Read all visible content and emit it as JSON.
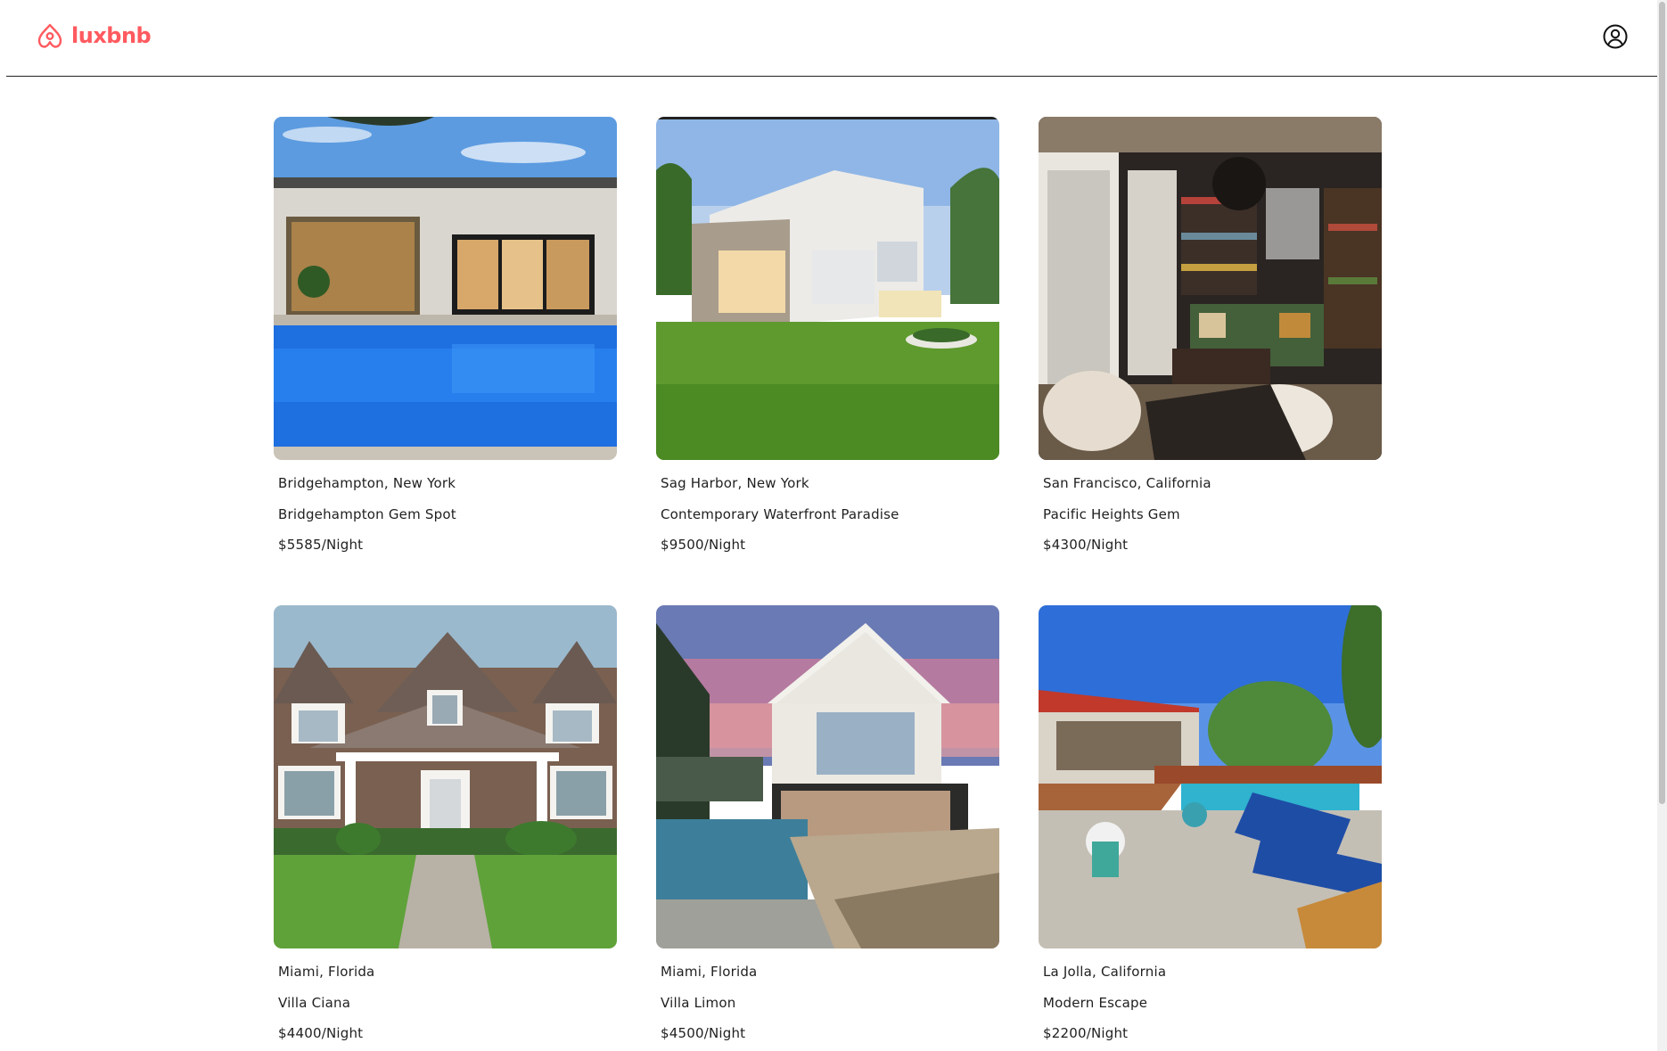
{
  "app": {
    "brand": "luxbnb",
    "brand_color": "#ff5a5f",
    "logo_icon": "airbnb-belo-icon",
    "user_icon": "user-circle-icon"
  },
  "listings": [
    {
      "location": "Bridgehampton, New York",
      "name": "Bridgehampton Gem Spot",
      "price": "$5585/Night",
      "image": "modern-house-with-pool-photo"
    },
    {
      "location": "Sag Harbor, New York",
      "name": "Contemporary Waterfront Paradise",
      "price": "$9500/Night",
      "image": "modern-white-house-lawn-photo"
    },
    {
      "location": "San Francisco, California",
      "name": "Pacific Heights Gem",
      "price": "$4300/Night",
      "image": "library-living-room-photo"
    },
    {
      "location": "Miami, Florida",
      "name": "Villa Ciana",
      "price": "$4400/Night",
      "image": "shingle-style-house-photo"
    },
    {
      "location": "Miami, Florida",
      "name": "Villa Limon",
      "price": "$4500/Night",
      "image": "sunset-house-pool-deck-photo"
    },
    {
      "location": "La Jolla, California",
      "name": "Modern Escape",
      "price": "$2200/Night",
      "image": "patio-pool-loungers-photo"
    }
  ]
}
